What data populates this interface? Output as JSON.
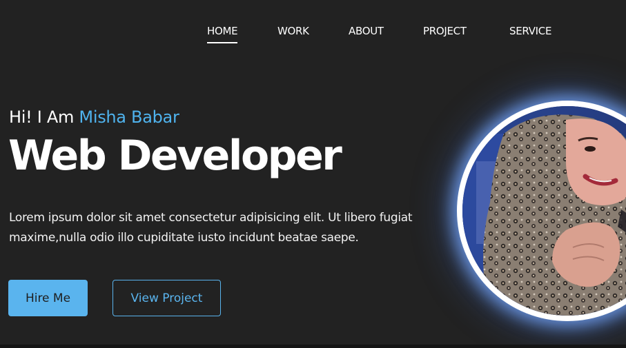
{
  "nav": {
    "items": [
      {
        "label": "HOME",
        "active": true
      },
      {
        "label": "WORK",
        "active": false
      },
      {
        "label": "ABOUT",
        "active": false
      },
      {
        "label": "PROJECT",
        "active": false
      },
      {
        "label": "SERVICE",
        "active": false
      }
    ]
  },
  "hero": {
    "greeting_prefix": "Hi! I Am",
    "name": "Misha Babar",
    "title": "Web Developer",
    "description": "Lorem ipsum dolor sit amet consectetur adipisicing elit. Ut libero fugiat maxime,nulla odio illo cupiditate iusto incidunt beatae saepe.",
    "primary_button": "Hire Me",
    "secondary_button": "View Project"
  },
  "colors": {
    "accent": "#5ab4ee",
    "background": "#222222",
    "text": "#ffffff"
  }
}
